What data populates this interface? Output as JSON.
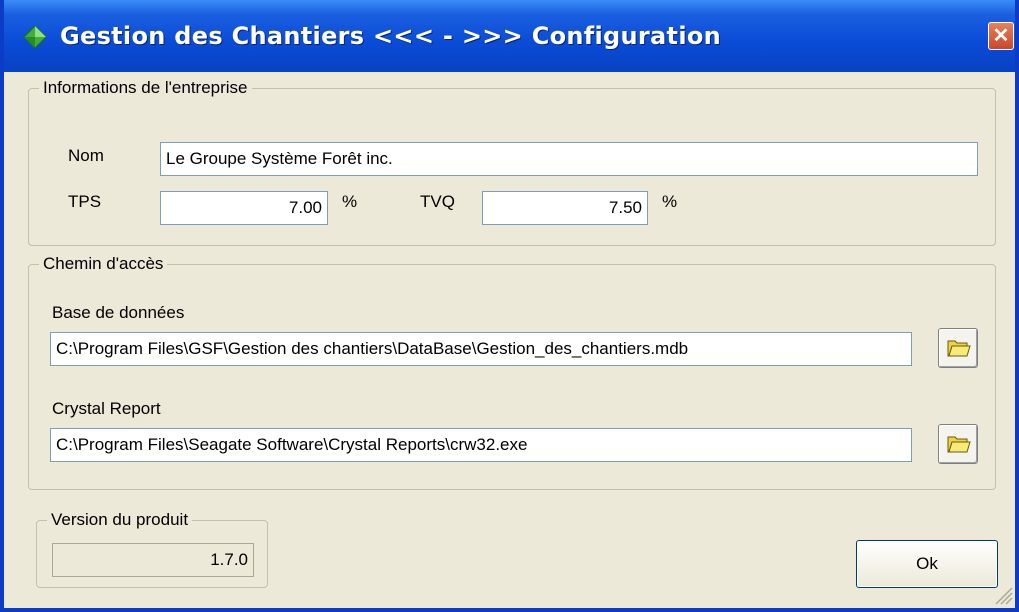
{
  "window": {
    "title": "Gestion des Chantiers <<< - >>> Configuration",
    "close_label": "✕"
  },
  "entreprise": {
    "legend": "Informations de l'entreprise",
    "nom_label": "Nom",
    "nom_value": "Le Groupe Système Forêt inc.",
    "tps_label": "TPS",
    "tps_value": "7.00",
    "tps_unit": "%",
    "tvq_label": "TVQ",
    "tvq_value": "7.50",
    "tvq_unit": "%"
  },
  "chemin": {
    "legend": "Chemin d'accès",
    "db_label": "Base de données",
    "db_value": "C:\\Program Files\\GSF\\Gestion des chantiers\\DataBase\\Gestion_des_chantiers.mdb",
    "crystal_label": "Crystal Report",
    "crystal_value": "C:\\Program Files\\Seagate Software\\Crystal Reports\\crw32.exe"
  },
  "version": {
    "legend": "Version du produit",
    "value": "1.7.0"
  },
  "buttons": {
    "ok_label": "Ok"
  },
  "icons": {
    "app": "app-gem-icon",
    "browse": "folder-open-icon"
  },
  "colors": {
    "titlebar": "#0a4bd6",
    "dialog_bg": "#ece9d8",
    "close": "#c8472a"
  }
}
